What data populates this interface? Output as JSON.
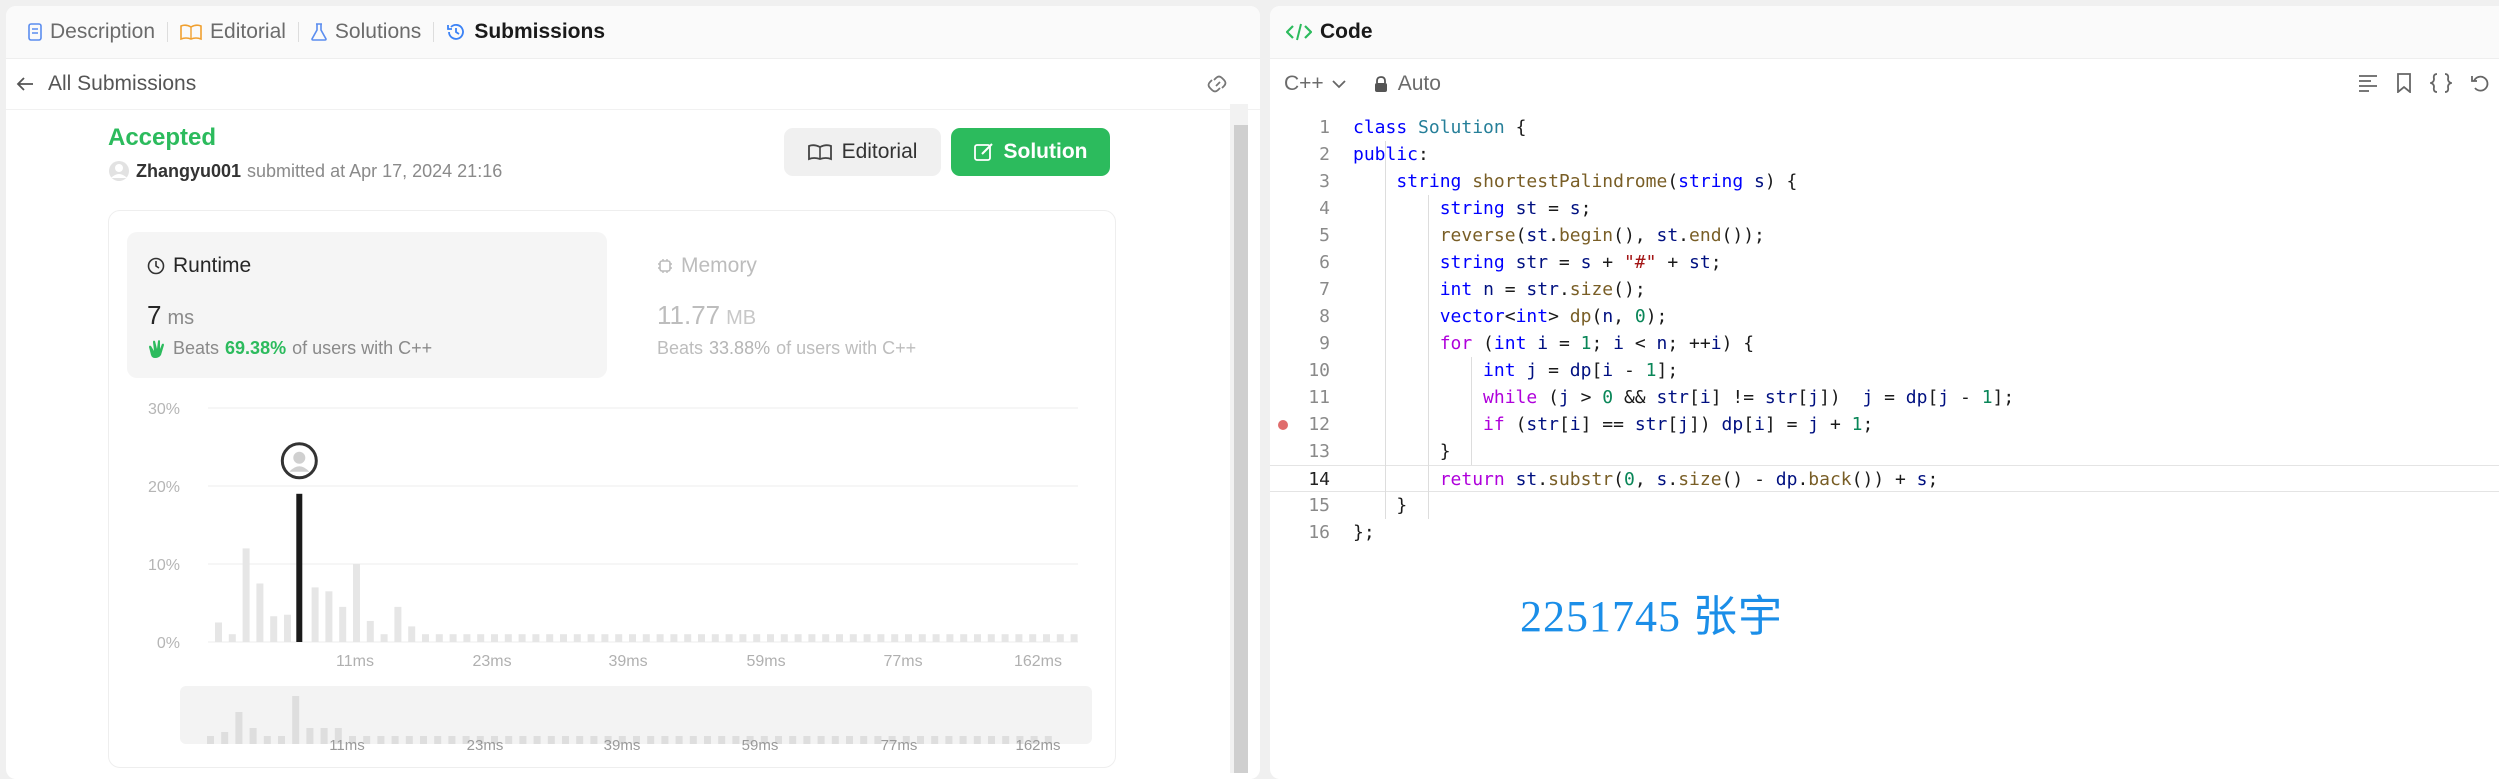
{
  "left": {
    "tabs": [
      {
        "label": "Description",
        "icon": "description-icon"
      },
      {
        "label": "Editorial",
        "icon": "book-icon"
      },
      {
        "label": "Solutions",
        "icon": "flask-icon"
      },
      {
        "label": "Submissions",
        "icon": "history-icon"
      }
    ],
    "back_label": "All Submissions",
    "status": "Accepted",
    "user": "Zhangyu001",
    "submitted_text": "submitted at Apr 17, 2024 21:16",
    "editorial_button": "Editorial",
    "solution_button": "Solution",
    "runtime": {
      "title": "Runtime",
      "value": "7",
      "unit": "ms",
      "beats_prefix": "Beats",
      "beats": "69.38%",
      "beats_suffix": "of users with C++"
    },
    "memory": {
      "title": "Memory",
      "value": "11.77",
      "unit": "MB",
      "beats_prefix": "Beats",
      "beats": "33.88%",
      "beats_suffix": "of users with C++"
    }
  },
  "chart_data": {
    "type": "bar",
    "y_ticks": [
      "30%",
      "20%",
      "10%",
      "0%"
    ],
    "ylim": [
      0,
      30
    ],
    "x_tick_labels": [
      "11ms",
      "23ms",
      "39ms",
      "59ms",
      "77ms",
      "162ms"
    ],
    "values": [
      2.5,
      1,
      12,
      7.5,
      3.3,
      3.5,
      19,
      7,
      6.5,
      4.5,
      10,
      2.7,
      1,
      4.5,
      2,
      1,
      1,
      1,
      1,
      1,
      1,
      1,
      1,
      1,
      1,
      1,
      1,
      1,
      1,
      1,
      1,
      1,
      1,
      1,
      1,
      1,
      1,
      1,
      1,
      1,
      1,
      1,
      1,
      1,
      1,
      1,
      1,
      1,
      1,
      1,
      1,
      1,
      1,
      1,
      1,
      1,
      1,
      1,
      1,
      1,
      1,
      1,
      1
    ],
    "highlight_index": 6,
    "grid": true
  },
  "mini_chart": {
    "x_tick_labels": [
      "11ms",
      "23ms",
      "39ms",
      "59ms",
      "77ms",
      "162ms"
    ],
    "values": [
      1,
      1.5,
      4,
      2,
      1,
      1,
      6,
      2,
      2,
      2,
      1,
      1,
      1,
      1,
      1,
      1,
      1,
      1,
      1,
      1,
      1,
      1,
      1,
      1,
      1,
      1,
      1,
      1,
      1,
      1,
      1,
      1,
      1,
      1,
      1,
      1,
      1,
      1,
      1,
      1,
      1,
      1,
      1,
      1,
      1,
      1,
      1,
      1,
      1,
      1,
      1,
      1,
      1,
      1,
      1,
      1,
      1,
      1,
      1,
      1
    ]
  },
  "right": {
    "title": "Code",
    "language": "C++",
    "mode": "Auto",
    "current_line": 14,
    "breakpoint_line": 12,
    "lines": [
      "class Solution {",
      "public:",
      "    string shortestPalindrome(string s) {",
      "        string st = s;",
      "        reverse(st.begin(), st.end());",
      "        string str = s + \"#\" + st;",
      "        int n = str.size();",
      "        vector<int> dp(n, 0);",
      "        for (int i = 1; i < n; ++i) {",
      "            int j = dp[i - 1];",
      "            while (j > 0 && str[i] != str[j])  j = dp[j - 1];",
      "            if (str[i] == str[j]) dp[i] = j + 1;",
      "        }",
      "        return st.substr(0, s.size() - dp.back()) + s;",
      "    }",
      "};"
    ],
    "stamp": "2251745  张宇"
  }
}
